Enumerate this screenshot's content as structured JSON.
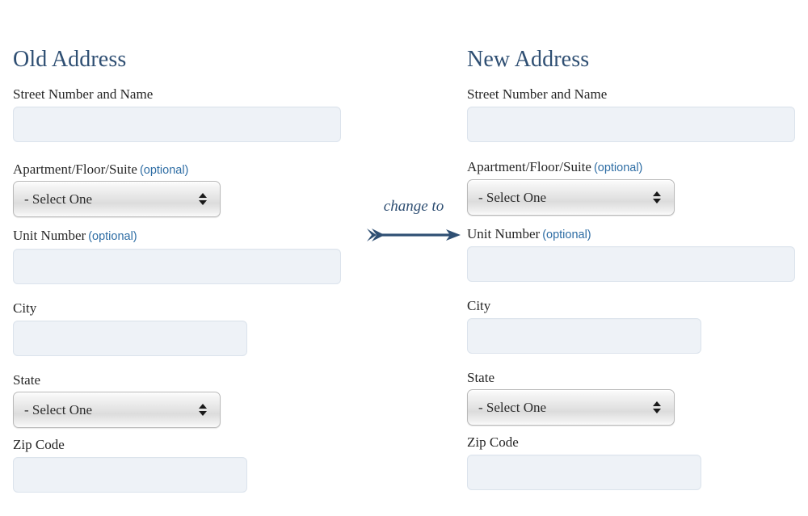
{
  "page": {
    "background_color": "#ffffff",
    "heading_color": "#2f4f73",
    "label_color": "#262626",
    "optional_color": "#2e6da4",
    "input_fill": "#eef2f7",
    "input_border": "#dbe3ec",
    "arrow_color": "#2f4f73"
  },
  "old_address": {
    "heading": "Old Address",
    "fields": {
      "street": {
        "label": "Street Number and Name",
        "value": "",
        "placeholder": ""
      },
      "apartment": {
        "label": "Apartment/Floor/Suite",
        "optional_text": "(optional)",
        "selected": "- Select One",
        "options": [
          "- Select One"
        ]
      },
      "unit": {
        "label": "Unit Number",
        "optional_text": "(optional)",
        "value": "",
        "placeholder": ""
      },
      "city": {
        "label": "City",
        "value": "",
        "placeholder": ""
      },
      "state": {
        "label": "State",
        "selected": "- Select One",
        "options": [
          "- Select One"
        ]
      },
      "zip": {
        "label": "Zip Code",
        "value": "",
        "placeholder": ""
      }
    }
  },
  "new_address": {
    "heading": "New Address",
    "fields": {
      "street": {
        "label": "Street Number and Name",
        "value": "",
        "placeholder": ""
      },
      "apartment": {
        "label": "Apartment/Floor/Suite",
        "optional_text": "(optional)",
        "selected": "- Select One",
        "options": [
          "- Select One"
        ]
      },
      "unit": {
        "label": "Unit Number",
        "optional_text": "(optional)",
        "value": "",
        "placeholder": ""
      },
      "city": {
        "label": "City",
        "value": "",
        "placeholder": ""
      },
      "state": {
        "label": "State",
        "selected": "- Select One",
        "options": [
          "- Select One"
        ]
      },
      "zip": {
        "label": "Zip Code",
        "value": "",
        "placeholder": ""
      }
    }
  },
  "transition": {
    "label": "change to",
    "icon": "right-arrow-icon"
  }
}
